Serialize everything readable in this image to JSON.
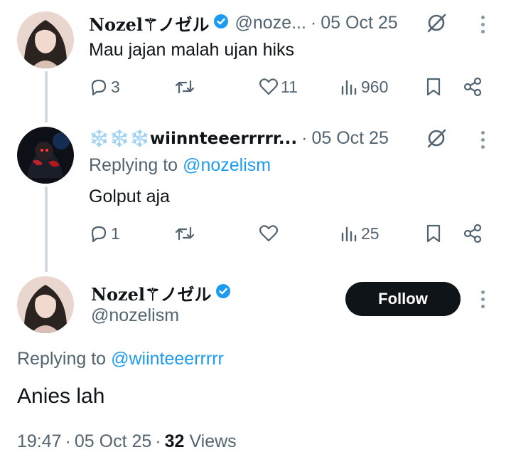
{
  "tweets": [
    {
      "name": "Nozel⚚ノゼル",
      "handle": "@noze...",
      "separator": "·",
      "date": "05 Oct 25",
      "text": "Mau jajan malah ujan hiks",
      "metrics": {
        "replies": "3",
        "retweets": "",
        "likes": "11",
        "views": "960"
      }
    },
    {
      "name": "❄️❄️❄️wiinnteeerrrrr...",
      "separator": "·",
      "date": "05 Oct 25",
      "replying_prefix": "Replying to",
      "replying_to": "@nozelism",
      "text": "Golput aja",
      "metrics": {
        "replies": "1",
        "retweets": "",
        "likes": "",
        "views": "25"
      }
    }
  ],
  "main_tweet": {
    "name": "Nozel⚚ノゼル",
    "handle": "@nozelism",
    "follow_label": "Follow",
    "replying_prefix": "Replying to",
    "replying_to": "@wiinteeerrrrr",
    "text": "Anies lah",
    "time": "19:47",
    "separator": "·",
    "date": "05 Oct 25",
    "views_count": "32",
    "views_label": "Views"
  },
  "colors": {
    "accent": "#1d9bf0",
    "muted": "#536471",
    "line": "#cfd9de",
    "button": "#0f1419"
  },
  "icons": [
    "reply-icon",
    "retweet-icon",
    "like-icon",
    "views-icon",
    "bookmark-icon",
    "share-icon",
    "grok-icon",
    "more-icon",
    "verified-badge-icon"
  ]
}
